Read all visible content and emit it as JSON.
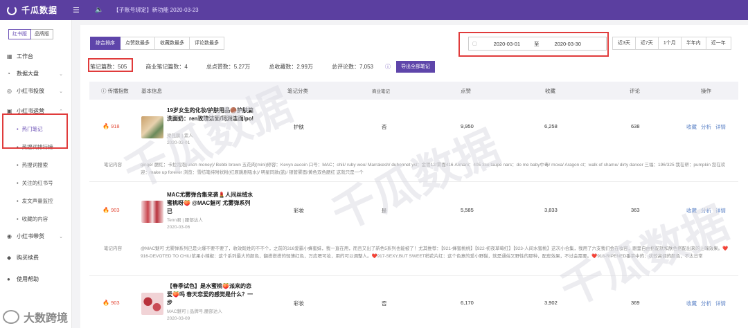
{
  "topbar": {
    "brand": "千瓜数据",
    "menu_icon": "menu-icon",
    "notice_icon": "speaker-icon",
    "notice_text": "【子账号绑定】新功能  2020-03-23"
  },
  "sidebar": {
    "switch": [
      "红书版",
      "品牌版"
    ],
    "items": [
      {
        "label": "工作台",
        "icon": "grid-icon"
      },
      {
        "label": "数据大盘",
        "icon": "chart-icon"
      },
      {
        "label": "小红书投放",
        "icon": "target-icon"
      },
      {
        "label": "小红书运营",
        "icon": "operate-icon"
      }
    ],
    "sub_items": [
      "热门笔记",
      "热搜词排行榜",
      "热搜词搜索",
      "关注的红书号",
      "发文声量监控",
      "收藏的内容"
    ],
    "items_after": [
      {
        "label": "小红书带货",
        "icon": "cart-icon"
      },
      {
        "label": "购买续费",
        "icon": "buy-icon"
      },
      {
        "label": "使用帮助",
        "icon": "help-icon"
      }
    ]
  },
  "main": {
    "sort_tabs": [
      "综合排序",
      "点赞数最多",
      "收藏数最多",
      "评论数最多"
    ],
    "date_start": "2020-03-01",
    "date_to": "至",
    "date_end": "2020-03-30",
    "quick_ranges": [
      "近3天",
      "近7天",
      "1个月",
      "半年内",
      "近一年"
    ],
    "stats": {
      "notes": "笔记篇数：505",
      "commercial": "商业笔记篇数：4",
      "likes": "总点赞数：5.27万",
      "collects": "总收藏数：2.99万",
      "comments": "总评论数：7,053",
      "export": "导出全部笔记"
    },
    "headers": [
      "传播指数",
      "基本信息",
      "笔记分类",
      "商业笔记",
      "点赞",
      "收藏",
      "评论",
      "操作"
    ],
    "rows": [
      {
        "index": "918",
        "title": "19岁女生的化妆/护肤用品🟤护肤篇 洗面奶：ren玫瑰洁面/珂润洁面/pol",
        "author": "梁昆鹏 | 素人",
        "date": "2020-03-01",
        "category": "护肤",
        "commercial": "否",
        "likes": "9,950",
        "collects": "6,258",
        "comments": "638",
        "ops": [
          "收藏",
          "分析",
          "详情"
        ],
        "content_label": "笔记内容",
        "content": "ginger 腮红：卡拉泡泡(unch money)/ Bobbi brown 五花肉(mini)修容：Kevyn aucoin 口号：MAC：chili/ ruby woo/ Marrakesh/ dubonnet ysl：金管12/雾面416 Armani：405 3ce taupe nars：do me baby中毒/ moxa/ Aragon ct：walk of shame/ dirty dancer 三福：196/325 我在帮：pumpkin 您在欢迎：make up forever 浏览：雪纺笔持附状粉(红原跳剧吸水)/ 明星同款(蓝)/ 银管雾面/黄色双色腮红 这就只是一个"
      },
      {
        "index": "903",
        "title": "MAC尤雾弹合集来袭💄人间丝绒水蜜桃呀🍑 @MAC魅可 尤雾弹系列已",
        "author": "Tenn君 | 腰部达人",
        "date": "2020-03-06",
        "category": "彩妆",
        "commercial": "是",
        "likes": "5,585",
        "collects": "3,833",
        "comments": "363",
        "ops": [
          "收藏",
          "分析",
          "详情"
        ],
        "content_label": "笔记内容",
        "content": "@MAC魅可 尤雾弹系列已是火爆不要不要了，收效既姓的不不个，之前的316爱霸小蜂蜜妹，我一直在用，而且又出了新色5系列也能被了！尤其推荐：【921-蜂蜜桃桃】【922-初夜草莓红】【923-人间水蜜桃】这次小合集，我用了六支我们会在妆容，跟里自由搭配就和肤色搭配出来的上嘴效果。❤️916-DEVOTED TO CHILI浆果小辣椒：这个系列最大的颜色，翻搭搭搭的轻薄红色，万应嗯可妆，用的可以调整人。❤️917-SEXY,BUT SWEET稍花片红：这个色意的爱小野猫，就是通俗又野性的那种，配皮效果，不过会需要。❤️918-RIPENED番茶中的：状较高调的颜色，不太日常"
      },
      {
        "index": "903",
        "title": "【春季试色】是水蜜桃🍑派来的恋爱🍑吗 春天恋爱的感觉是什么？一步",
        "author": "MAC魅可 | 品牌号,腰部达人",
        "date": "2020-03-09",
        "category": "彩妆",
        "commercial": "否",
        "likes": "6,170",
        "collects": "3,902",
        "comments": "369",
        "ops": [
          "收藏",
          "分析",
          "详情"
        ]
      }
    ]
  },
  "watermark": "千瓜数据",
  "corner_brand": "大数跨境",
  "colors": {
    "brand": "#5b3fa0",
    "accent": "#5e45aa",
    "highlight_box": "#e03b3b",
    "fire": "#e34d3b",
    "link": "#5b82c6"
  }
}
